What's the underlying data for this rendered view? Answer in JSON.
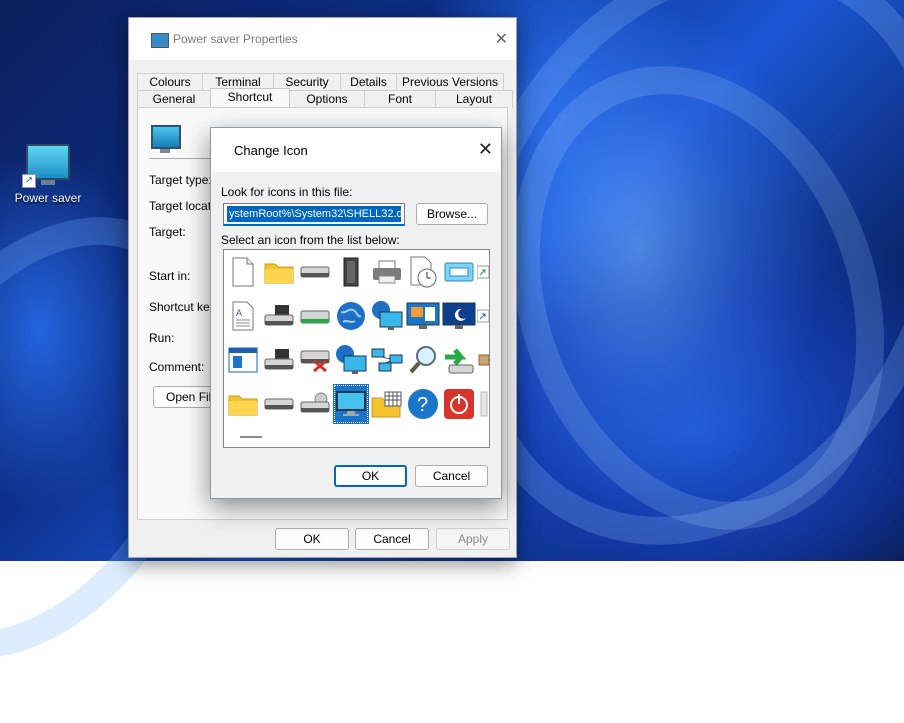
{
  "desktop": {
    "shortcut_label": "Power saver"
  },
  "properties": {
    "title": "Power saver Properties",
    "tabs_back": [
      "Colours",
      "Terminal",
      "Security",
      "Details",
      "Previous Versions"
    ],
    "tabs_front": [
      "General",
      "Shortcut",
      "Options",
      "Font",
      "Layout"
    ],
    "active_tab": "Shortcut",
    "labels": {
      "target_type": "Target type:",
      "target_location": "Target location",
      "target": "Target:",
      "start_in": "Start in:",
      "shortcut_key": "Shortcut key:",
      "run": "Run:",
      "comment": "Comment:"
    },
    "open_file_button": "Open File",
    "ok": "OK",
    "cancel": "Cancel",
    "apply": "Apply"
  },
  "change_icon": {
    "title": "Change Icon",
    "look_for_label": "Look for icons in this file:",
    "file_path": "ystemRoot%\\System32\\SHELL32.dll",
    "browse": "Browse...",
    "select_label": "Select an icon from the list below:",
    "icons": [
      "blank-document-icon",
      "folder-icon",
      "drive-icon",
      "memory-chip-icon",
      "printer-icon",
      "clock-document-icon",
      "app-window-icon",
      "shortcut-partial-icon",
      "text-document-icon",
      "floppy-drive-icon",
      "removable-drive-icon",
      "globe-icon",
      "network-globe-monitor-icon",
      "control-panel-monitor-icon",
      "sleep-monitor-icon",
      "shortcut-partial-icon",
      "window-document-icon",
      "floppy-drive-icon",
      "disconnected-drive-icon",
      "network-globe-icon",
      "network-icon",
      "search-magnifier-icon",
      "recycle-arrow-icon",
      "box-partial-icon",
      "folder-icon",
      "drive-icon",
      "cd-drive-icon",
      "monitor-icon",
      "folder-grid-icon",
      "help-icon",
      "power-icon",
      "partial-icon"
    ],
    "selected_icon": "monitor-icon",
    "ok": "OK",
    "cancel": "Cancel"
  }
}
